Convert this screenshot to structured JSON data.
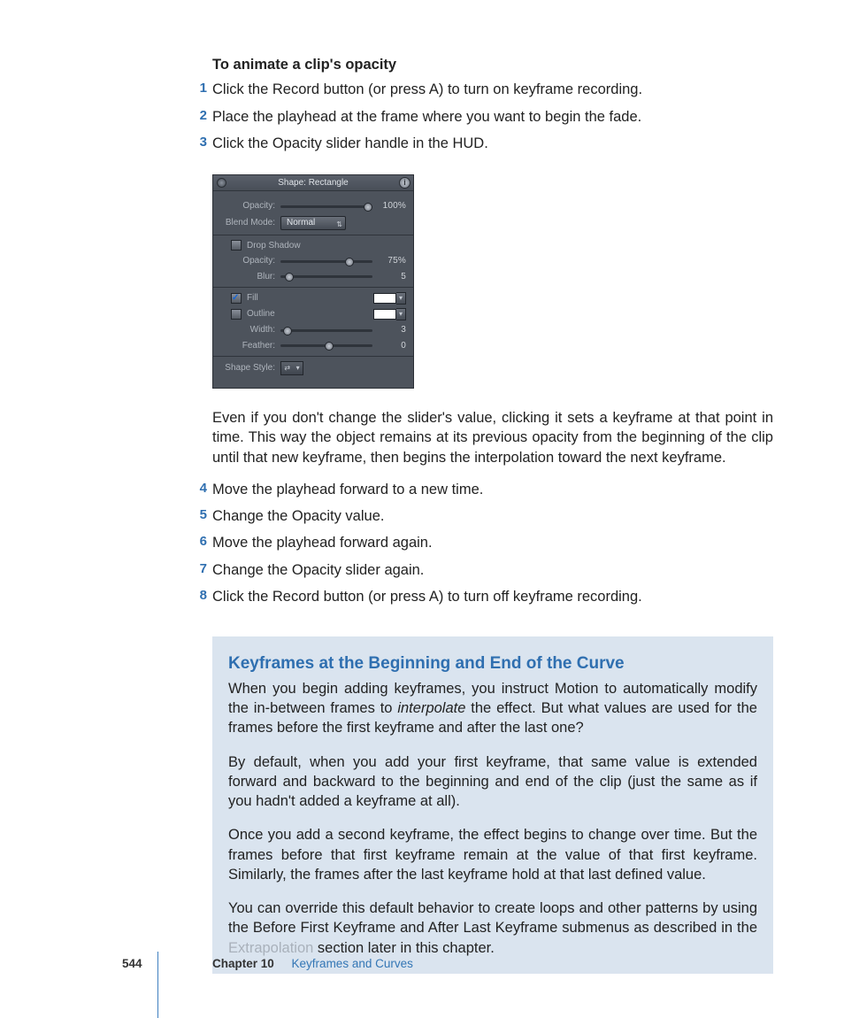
{
  "task_title": "To animate a clip's opacity",
  "steps_top": [
    "Click the Record button (or press A) to turn on keyframe recording.",
    "Place the playhead at the frame where you want to begin the fade.",
    "Click the Opacity slider handle in the HUD."
  ],
  "paragraph_mid": "Even if you don't change the slider's value, clicking it sets a keyframe at that point in time. This way the object remains at its previous opacity from the beginning of the clip until that new keyframe, then begins the interpolation toward the next keyframe.",
  "steps_bottom": [
    "Move the playhead forward to a new time.",
    "Change the Opacity value.",
    "Move the playhead forward again.",
    "Change the Opacity slider again.",
    "Click the Record button (or press A) to turn off keyframe recording."
  ],
  "step_numbers_top": [
    "1",
    "2",
    "3"
  ],
  "step_numbers_bottom": [
    "4",
    "5",
    "6",
    "7",
    "8"
  ],
  "hud": {
    "title": "Shape: Rectangle",
    "close": "×",
    "info": "i",
    "labels": {
      "opacity": "Opacity:",
      "blend": "Blend Mode:",
      "drop": "Drop Shadow",
      "opacity2": "Opacity:",
      "blur": "Blur:",
      "fill": "Fill",
      "outline": "Outline",
      "width": "Width:",
      "feather": "Feather:",
      "style": "Shape Style:"
    },
    "values": {
      "opacity": "100%",
      "blend": "Normal",
      "opacity2": "75%",
      "blur": "5",
      "width": "3",
      "feather": "0"
    },
    "select_arrow": "⇅",
    "swatch_arrow": "▾"
  },
  "callout": {
    "title": "Keyframes at the Beginning and End of the Curve",
    "p1a": "When you begin adding keyframes, you instruct Motion to automatically modify the in-between frames to ",
    "p1_em": "interpolate",
    "p1b": " the effect. But what values are used for the frames before the first keyframe and after the last one?",
    "p2": "By default, when you add your first keyframe, that same value is extended forward and backward to the beginning and end of the clip (just the same as if you hadn't added a keyframe at all).",
    "p3": "Once you add a second keyframe, the effect begins to change over time. But the frames before that first keyframe remain at the value of that first keyframe. Similarly, the frames after the last keyframe hold at that last defined value.",
    "p4a": "You can override this default behavior to create loops and other patterns by using the Before First Keyframe and After Last Keyframe submenus as described in the ",
    "p4_link": "Extrapolation",
    "p4b": " section later in this chapter."
  },
  "footer": {
    "page": "544",
    "chapter": "Chapter 10",
    "title": "Keyframes and Curves"
  }
}
